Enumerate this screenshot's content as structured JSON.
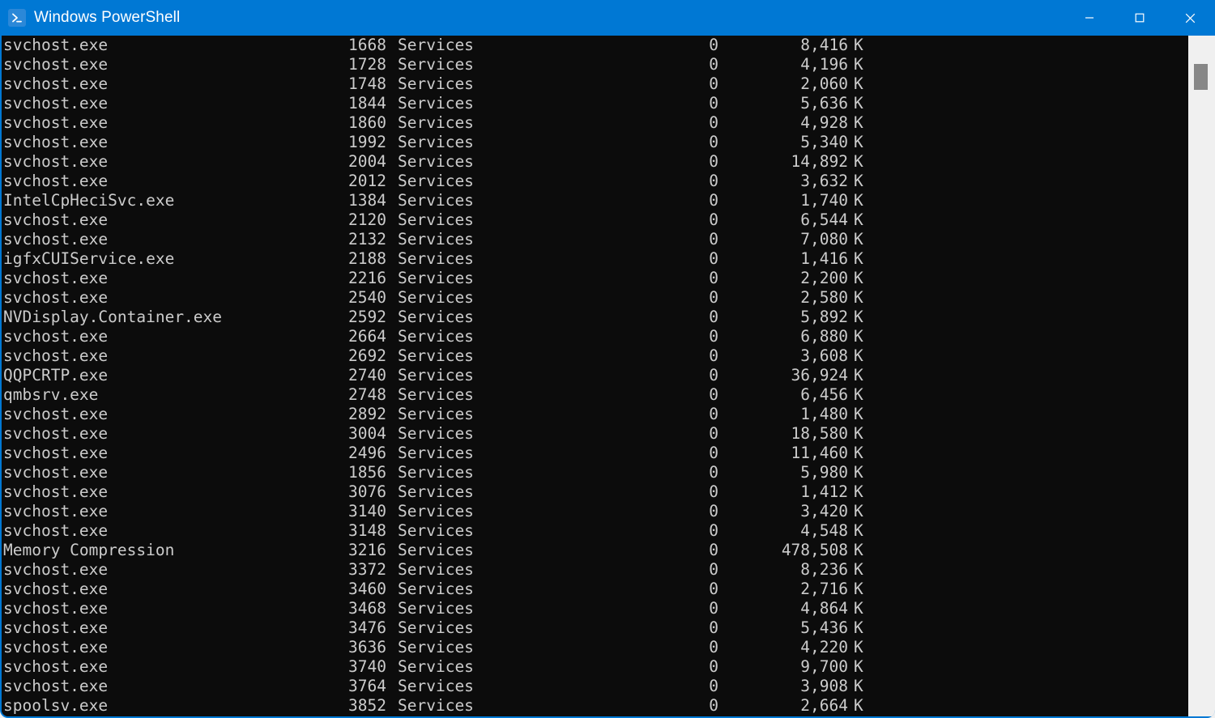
{
  "window": {
    "title": "Windows PowerShell",
    "app_icon": "powershell-prompt-icon",
    "accent_color": "#0078d4",
    "terminal_background": "#0c0c0c",
    "terminal_foreground": "#cccccc",
    "controls": {
      "minimize_label": "Minimize",
      "maximize_label": "Maximize",
      "close_label": "Close"
    }
  },
  "scrollbar": {
    "track_color": "#f0f0f0",
    "thumb_color": "#878787"
  },
  "terminal": {
    "rows": [
      {
        "name": "svchost.exe",
        "pid": "1668",
        "session": "Services",
        "session_num": "0",
        "mem": "8,416",
        "unit": "K"
      },
      {
        "name": "svchost.exe",
        "pid": "1728",
        "session": "Services",
        "session_num": "0",
        "mem": "4,196",
        "unit": "K"
      },
      {
        "name": "svchost.exe",
        "pid": "1748",
        "session": "Services",
        "session_num": "0",
        "mem": "2,060",
        "unit": "K"
      },
      {
        "name": "svchost.exe",
        "pid": "1844",
        "session": "Services",
        "session_num": "0",
        "mem": "5,636",
        "unit": "K"
      },
      {
        "name": "svchost.exe",
        "pid": "1860",
        "session": "Services",
        "session_num": "0",
        "mem": "4,928",
        "unit": "K"
      },
      {
        "name": "svchost.exe",
        "pid": "1992",
        "session": "Services",
        "session_num": "0",
        "mem": "5,340",
        "unit": "K"
      },
      {
        "name": "svchost.exe",
        "pid": "2004",
        "session": "Services",
        "session_num": "0",
        "mem": "14,892",
        "unit": "K"
      },
      {
        "name": "svchost.exe",
        "pid": "2012",
        "session": "Services",
        "session_num": "0",
        "mem": "3,632",
        "unit": "K"
      },
      {
        "name": "IntelCpHeciSvc.exe",
        "pid": "1384",
        "session": "Services",
        "session_num": "0",
        "mem": "1,740",
        "unit": "K"
      },
      {
        "name": "svchost.exe",
        "pid": "2120",
        "session": "Services",
        "session_num": "0",
        "mem": "6,544",
        "unit": "K"
      },
      {
        "name": "svchost.exe",
        "pid": "2132",
        "session": "Services",
        "session_num": "0",
        "mem": "7,080",
        "unit": "K"
      },
      {
        "name": "igfxCUIService.exe",
        "pid": "2188",
        "session": "Services",
        "session_num": "0",
        "mem": "1,416",
        "unit": "K"
      },
      {
        "name": "svchost.exe",
        "pid": "2216",
        "session": "Services",
        "session_num": "0",
        "mem": "2,200",
        "unit": "K"
      },
      {
        "name": "svchost.exe",
        "pid": "2540",
        "session": "Services",
        "session_num": "0",
        "mem": "2,580",
        "unit": "K"
      },
      {
        "name": "NVDisplay.Container.exe",
        "pid": "2592",
        "session": "Services",
        "session_num": "0",
        "mem": "5,892",
        "unit": "K"
      },
      {
        "name": "svchost.exe",
        "pid": "2664",
        "session": "Services",
        "session_num": "0",
        "mem": "6,880",
        "unit": "K"
      },
      {
        "name": "svchost.exe",
        "pid": "2692",
        "session": "Services",
        "session_num": "0",
        "mem": "3,608",
        "unit": "K"
      },
      {
        "name": "QQPCRTP.exe",
        "pid": "2740",
        "session": "Services",
        "session_num": "0",
        "mem": "36,924",
        "unit": "K"
      },
      {
        "name": "qmbsrv.exe",
        "pid": "2748",
        "session": "Services",
        "session_num": "0",
        "mem": "6,456",
        "unit": "K"
      },
      {
        "name": "svchost.exe",
        "pid": "2892",
        "session": "Services",
        "session_num": "0",
        "mem": "1,480",
        "unit": "K"
      },
      {
        "name": "svchost.exe",
        "pid": "3004",
        "session": "Services",
        "session_num": "0",
        "mem": "18,580",
        "unit": "K"
      },
      {
        "name": "svchost.exe",
        "pid": "2496",
        "session": "Services",
        "session_num": "0",
        "mem": "11,460",
        "unit": "K"
      },
      {
        "name": "svchost.exe",
        "pid": "1856",
        "session": "Services",
        "session_num": "0",
        "mem": "5,980",
        "unit": "K"
      },
      {
        "name": "svchost.exe",
        "pid": "3076",
        "session": "Services",
        "session_num": "0",
        "mem": "1,412",
        "unit": "K"
      },
      {
        "name": "svchost.exe",
        "pid": "3140",
        "session": "Services",
        "session_num": "0",
        "mem": "3,420",
        "unit": "K"
      },
      {
        "name": "svchost.exe",
        "pid": "3148",
        "session": "Services",
        "session_num": "0",
        "mem": "4,548",
        "unit": "K"
      },
      {
        "name": "Memory Compression",
        "pid": "3216",
        "session": "Services",
        "session_num": "0",
        "mem": "478,508",
        "unit": "K"
      },
      {
        "name": "svchost.exe",
        "pid": "3372",
        "session": "Services",
        "session_num": "0",
        "mem": "8,236",
        "unit": "K"
      },
      {
        "name": "svchost.exe",
        "pid": "3460",
        "session": "Services",
        "session_num": "0",
        "mem": "2,716",
        "unit": "K"
      },
      {
        "name": "svchost.exe",
        "pid": "3468",
        "session": "Services",
        "session_num": "0",
        "mem": "4,864",
        "unit": "K"
      },
      {
        "name": "svchost.exe",
        "pid": "3476",
        "session": "Services",
        "session_num": "0",
        "mem": "5,436",
        "unit": "K"
      },
      {
        "name": "svchost.exe",
        "pid": "3636",
        "session": "Services",
        "session_num": "0",
        "mem": "4,220",
        "unit": "K"
      },
      {
        "name": "svchost.exe",
        "pid": "3740",
        "session": "Services",
        "session_num": "0",
        "mem": "9,700",
        "unit": "K"
      },
      {
        "name": "svchost.exe",
        "pid": "3764",
        "session": "Services",
        "session_num": "0",
        "mem": "3,908",
        "unit": "K"
      },
      {
        "name": "spoolsv.exe",
        "pid": "3852",
        "session": "Services",
        "session_num": "0",
        "mem": "2,664",
        "unit": "K"
      }
    ]
  }
}
